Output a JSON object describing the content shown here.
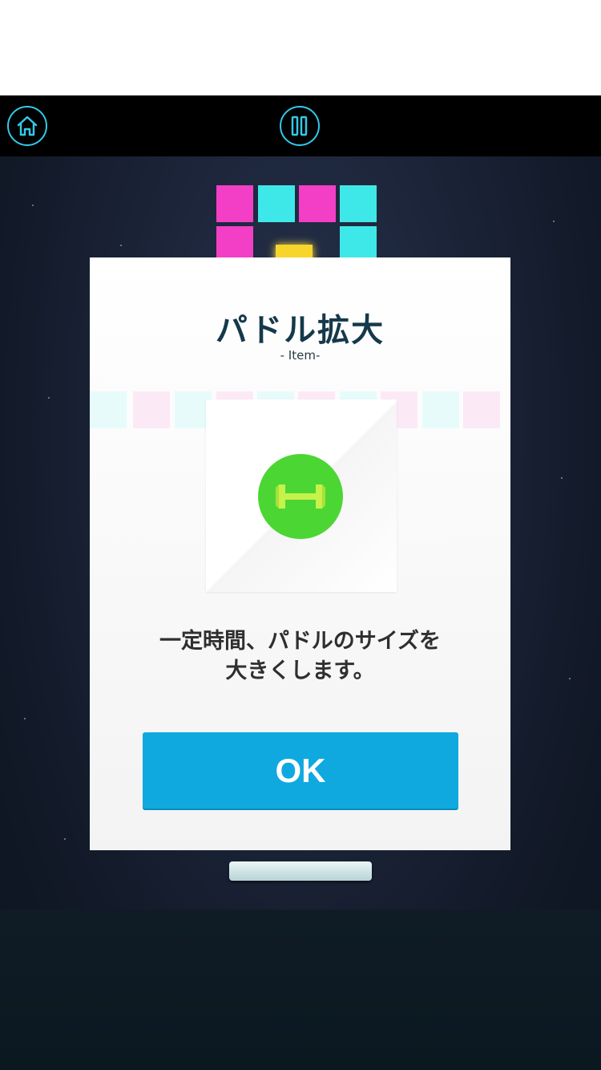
{
  "modal": {
    "title": "パドル拡大",
    "subtitle": "- Item-",
    "description_line1": "一定時間、パドルのサイズを",
    "description_line2": "大きくします。",
    "ok_label": "OK",
    "item_icon": "paddle-expand-icon"
  },
  "top_bar": {
    "home_icon": "home-icon",
    "pause_icon": "pause-icon"
  },
  "colors": {
    "accent": "#33c9e8",
    "ok_button": "#0fa9df",
    "item_icon_bg": "#4cd634",
    "title": "#15394a",
    "block_pink": "#f23fc6",
    "block_cyan": "#3fe8e8"
  }
}
